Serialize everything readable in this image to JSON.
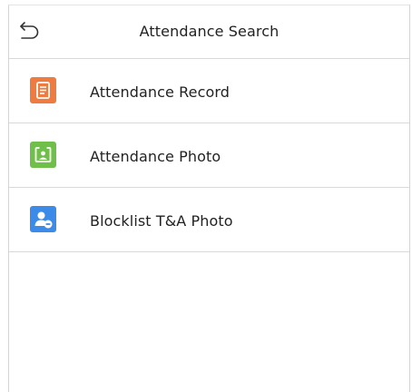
{
  "header": {
    "title": "Attendance Search",
    "back_icon": "back-arrow-icon"
  },
  "menu": {
    "items": [
      {
        "label": "Attendance Record",
        "icon": "document-icon",
        "color": "#ee7b3f"
      },
      {
        "label": "Attendance Photo",
        "icon": "photo-frame-icon",
        "color": "#6fbf4a"
      },
      {
        "label": "Blocklist T&A Photo",
        "icon": "user-block-icon",
        "color": "#3d8be8"
      }
    ]
  },
  "colors": {
    "background": "#ffffff",
    "divider": "#d9d9d9",
    "text": "#222222"
  }
}
